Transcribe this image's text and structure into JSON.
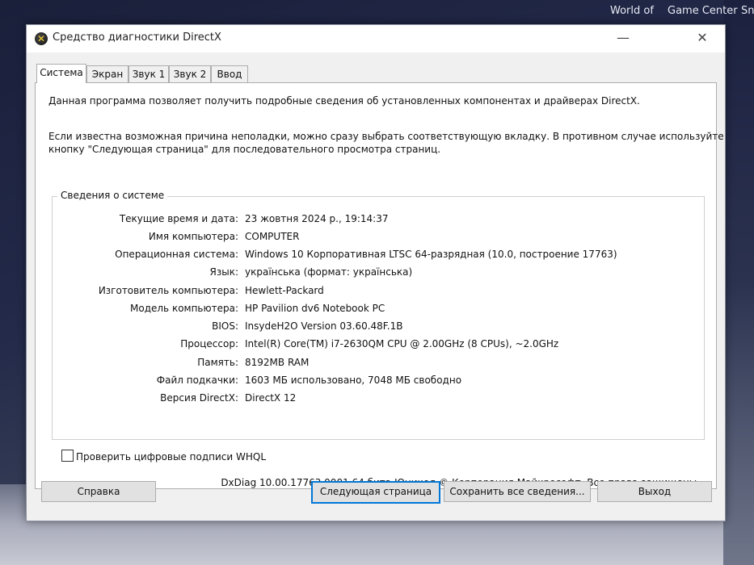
{
  "desktop": {
    "icons": [
      "World of",
      "Game Center",
      "Sn"
    ]
  },
  "window": {
    "title": "Средство диагностики DirectX",
    "minimize_glyph": "—",
    "close_glyph": "✕",
    "app_icon_glyph": "✕"
  },
  "tabs": [
    {
      "label": "Система"
    },
    {
      "label": "Экран"
    },
    {
      "label": "Звук 1"
    },
    {
      "label": "Звук 2"
    },
    {
      "label": "Ввод"
    }
  ],
  "intro": {
    "line1": "Данная программа позволяет получить подробные сведения об установленных компонентах и драйверах DirectX.",
    "line2": "Если известна возможная причина неполадки, можно сразу выбрать соответствующую вкладку. В противном случае используйте",
    "line3": "кнопку \"Следующая страница\" для последовательного просмотра страниц."
  },
  "system_info": {
    "title": "Сведения о системе",
    "rows": [
      {
        "label": "Текущие время и дата:",
        "value": "23 жовтня 2024 р., 19:14:37"
      },
      {
        "label": "Имя компьютера:",
        "value": "COMPUTER"
      },
      {
        "label": "Операционная система:",
        "value": "Windows 10 Корпоративная LTSC 64-разрядная (10.0, построение 17763)"
      },
      {
        "label": "Язык:",
        "value": "українська (формат: українська)"
      },
      {
        "label": "Изготовитель компьютера:",
        "value": "Hewlett-Packard"
      },
      {
        "label": "Модель компьютера:",
        "value": "HP Pavilion dv6 Notebook PC"
      },
      {
        "label": "BIOS:",
        "value": "InsydeH2O Version 03.60.48F.1B"
      },
      {
        "label": "Процессор:",
        "value": "Intel(R) Core(TM) i7-2630QM CPU @ 2.00GHz (8 CPUs), ~2.0GHz"
      },
      {
        "label": "Память:",
        "value": "8192MB RAM"
      },
      {
        "label": "Файл подкачки:",
        "value": "1603 МБ использовано, 7048 МБ свободно"
      },
      {
        "label": "Версия DirectX:",
        "value": "DirectX 12"
      }
    ]
  },
  "whql_checkbox": {
    "label": "Проверить цифровые подписи WHQL",
    "checked": false
  },
  "footer": {
    "copyright": "DxDiag 10.00.17763.0001 64 бита Юникод © Корпорация Майкрософт. Все права защищены."
  },
  "buttons": {
    "help": "Справка",
    "next": "Следующая страница",
    "save": "Сохранить все сведения...",
    "exit": "Выход"
  }
}
